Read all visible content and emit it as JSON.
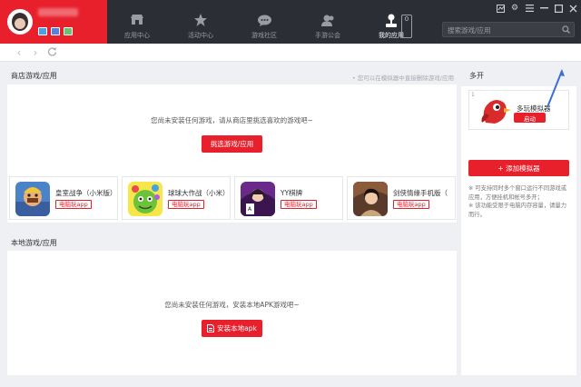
{
  "tabs": [
    {
      "label": "应用中心",
      "icon": "store-icon"
    },
    {
      "label": "活动中心",
      "icon": "star-icon"
    },
    {
      "label": "游戏社区",
      "icon": "chat-icon"
    },
    {
      "label": "手游公会",
      "icon": "users-icon"
    },
    {
      "label": "我的应用",
      "icon": "joystick-icon"
    }
  ],
  "active_tab": "我的应用",
  "counter": "0",
  "search": {
    "placeholder": "搜索游戏/应用"
  },
  "store": {
    "title": "商店游戏/应用",
    "hint": "• 您可以在模拟器中直接删除游戏/应用",
    "empty_msg": "您尚未安装任何游戏，请从商店里挑选喜欢的游戏吧~",
    "button": "挑选游戏/应用"
  },
  "games": [
    {
      "name": "皇室战争（小米版）",
      "tag": "电脑玩app"
    },
    {
      "name": "球球大作战（小米）",
      "tag": "电脑玩app"
    },
    {
      "name": "YY棋牌",
      "tag": "电脑玩app"
    },
    {
      "name": "剑侠情缘手机版（",
      "tag": "电脑玩app"
    }
  ],
  "local": {
    "title": "本地游戏/应用",
    "empty_msg": "您尚未安装任何游戏，安装本地APK游戏吧~",
    "button": "安装本地apk"
  },
  "multi": {
    "title": "多开",
    "emulator": {
      "number": "1",
      "name": "多玩模拟器",
      "start": "启动"
    },
    "add": "+ 添加模拟器",
    "notes": "※ 可支持同时多个窗口运行不同游戏或应用，方便挂机和帐号多开；\n※ 该功能受限于电脑内存容量，请量力而行。"
  },
  "colors": {
    "accent": "#e8202c",
    "topbar": "#2c2e36"
  }
}
